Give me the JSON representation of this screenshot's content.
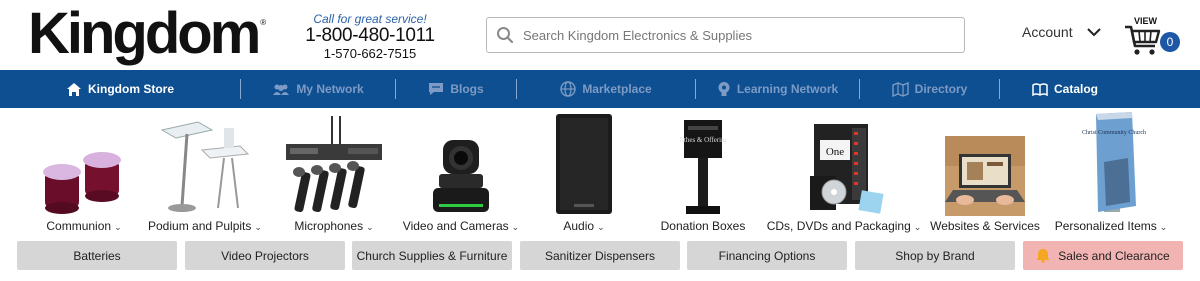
{
  "header": {
    "logo_text": "Kingdom",
    "logo_reg": "®",
    "phone_tagline": "Call for great service!",
    "phone_main": "1-800-480-1011",
    "phone_alt": "1-570-662-7515",
    "search_placeholder": "Search Kingdom Electronics & Supplies",
    "account_label": "Account",
    "cart_view_label": "VIEW",
    "cart_count": "0"
  },
  "nav": {
    "items": [
      {
        "label": "Kingdom Store",
        "icon": "home-icon",
        "active": true
      },
      {
        "label": "My Network",
        "icon": "people-icon",
        "active": false
      },
      {
        "label": "Blogs",
        "icon": "chat-icon",
        "active": false
      },
      {
        "label": "Marketplace",
        "icon": "globe-icon",
        "active": false
      },
      {
        "label": "Learning Network",
        "icon": "bulb-icon",
        "active": false
      },
      {
        "label": "Directory",
        "icon": "map-icon",
        "active": false
      },
      {
        "label": "Catalog",
        "icon": "book-icon",
        "active": true
      }
    ]
  },
  "categories": [
    {
      "label": "Communion",
      "has_dropdown": true
    },
    {
      "label": "Podium and Pulpits",
      "has_dropdown": true
    },
    {
      "label": "Microphones",
      "has_dropdown": true
    },
    {
      "label": "Video and Cameras",
      "has_dropdown": true
    },
    {
      "label": "Audio",
      "has_dropdown": true
    },
    {
      "label": "Donation Boxes",
      "has_dropdown": false
    },
    {
      "label": "CDs, DVDs and Packaging",
      "has_dropdown": true
    },
    {
      "label": "Websites & Services",
      "has_dropdown": false
    },
    {
      "label": "Personalized Items",
      "has_dropdown": true
    }
  ],
  "product_image_text": {
    "donation_box": "Tithes & Offering",
    "cd_tower": "One",
    "banner": "Christ Community Church"
  },
  "pills": [
    {
      "label": "Batteries"
    },
    {
      "label": "Video Projectors"
    },
    {
      "label": "Church Supplies & Furniture"
    },
    {
      "label": "Sanitizer Dispensers"
    },
    {
      "label": "Financing Options"
    },
    {
      "label": "Shop by Brand"
    },
    {
      "label": "Sales and Clearance",
      "highlight": true,
      "icon": "bell-icon"
    }
  ],
  "colors": {
    "nav_bg": "#0d4f91",
    "nav_active": "#ffffff",
    "nav_inactive": "#7d9bc4",
    "phone_tagline": "#2a62a9",
    "cart_badge": "#1d57a6",
    "pill_bg": "#d6d6d6",
    "sale_bg": "#f2b3b3",
    "sale_icon": "#f5a623"
  }
}
